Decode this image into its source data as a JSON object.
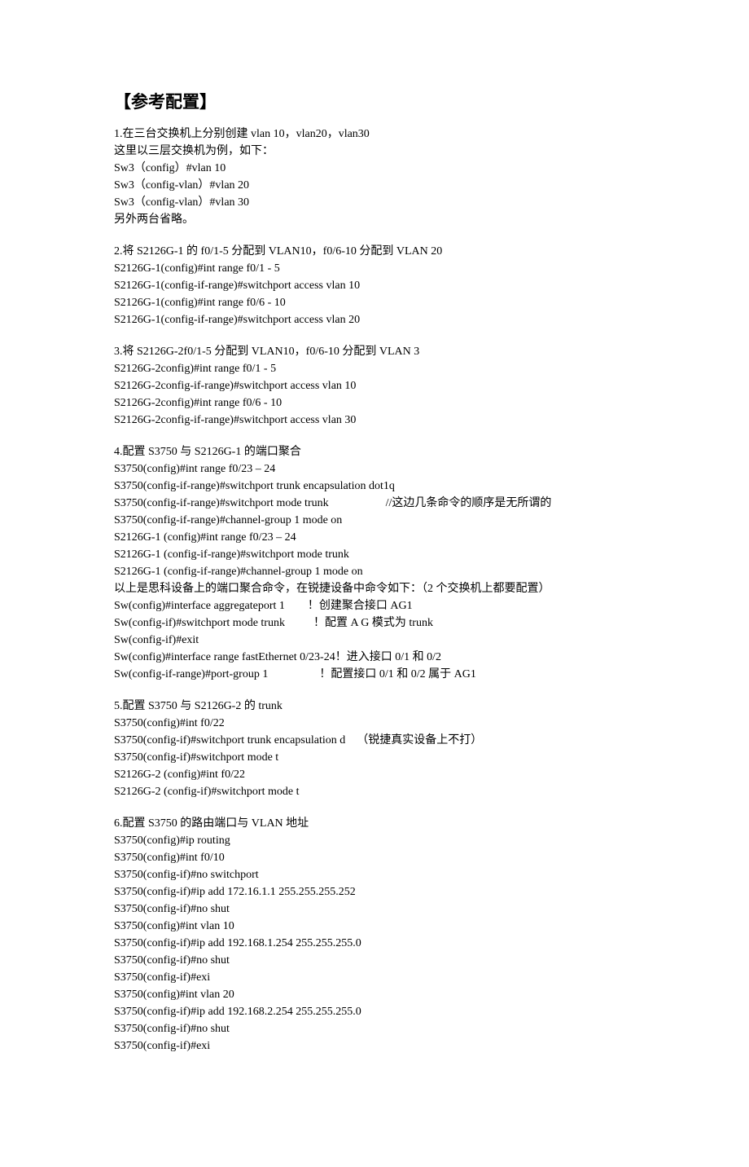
{
  "title": "【参考配置】",
  "sections": [
    "1.在三台交换机上分别创建 vlan 10，vlan20，vlan30\n这里以三层交换机为例，如下：\nSw3（config）#vlan 10\nSw3（config-vlan）#vlan 20\nSw3（config-vlan）#vlan 30\n另外两台省略。",
    "2.将 S2126G-1 的 f0/1-5 分配到 VLAN10，f0/6-10 分配到 VLAN 20\nS2126G-1(config)#int range f0/1 - 5\nS2126G-1(config-if-range)#switchport access vlan 10\nS2126G-1(config)#int range f0/6 - 10\nS2126G-1(config-if-range)#switchport access vlan 20",
    "3.将 S2126G-2f0/1-5 分配到 VLAN10，f0/6-10 分配到 VLAN 3\nS2126G-2config)#int range f0/1 - 5\nS2126G-2config-if-range)#switchport access vlan 10\nS2126G-2config)#int range f0/6 - 10\nS2126G-2config-if-range)#switchport access vlan 30",
    "4.配置 S3750 与 S2126G-1 的端口聚合\nS3750(config)#int range f0/23 – 24\nS3750(config-if-range)#switchport trunk encapsulation dot1q\nS3750(config-if-range)#switchport mode trunk                    //这边几条命令的顺序是无所谓的\nS3750(config-if-range)#channel-group 1 mode on\nS2126G-1 (config)#int range f0/23 – 24\nS2126G-1 (config-if-range)#switchport mode trunk\nS2126G-1 (config-if-range)#channel-group 1 mode on\n以上是思科设备上的端口聚合命令，在锐捷设备中命令如下：（2 个交换机上都要配置）\nSw(config)#interface aggregateport 1        ！创建聚合接口 AG1\nSw(config-if)#switchport mode trunk          ！配置 A G 模式为 trunk\nSw(config-if)#exit\nSw(config)#interface range fastEthernet 0/23-24！进入接口 0/1 和 0/2\nSw(config-if-range)#port-group 1                  ！配置接口 0/1 和 0/2 属于 AG1",
    "5.配置 S3750 与 S2126G-2 的 trunk\nS3750(config)#int f0/22\nS3750(config-if)#switchport trunk encapsulation d    （锐捷真实设备上不打）\nS3750(config-if)#switchport mode t\nS2126G-2 (config)#int f0/22\nS2126G-2 (config-if)#switchport mode t",
    "6.配置 S3750 的路由端口与 VLAN 地址\nS3750(config)#ip routing\nS3750(config)#int f0/10\nS3750(config-if)#no switchport\nS3750(config-if)#ip add 172.16.1.1 255.255.255.252\nS3750(config-if)#no shut\nS3750(config)#int vlan 10\nS3750(config-if)#ip add 192.168.1.254 255.255.255.0\nS3750(config-if)#no shut\nS3750(config-if)#exi\nS3750(config)#int vlan 20\nS3750(config-if)#ip add 192.168.2.254 255.255.255.0\nS3750(config-if)#no shut\nS3750(config-if)#exi"
  ]
}
